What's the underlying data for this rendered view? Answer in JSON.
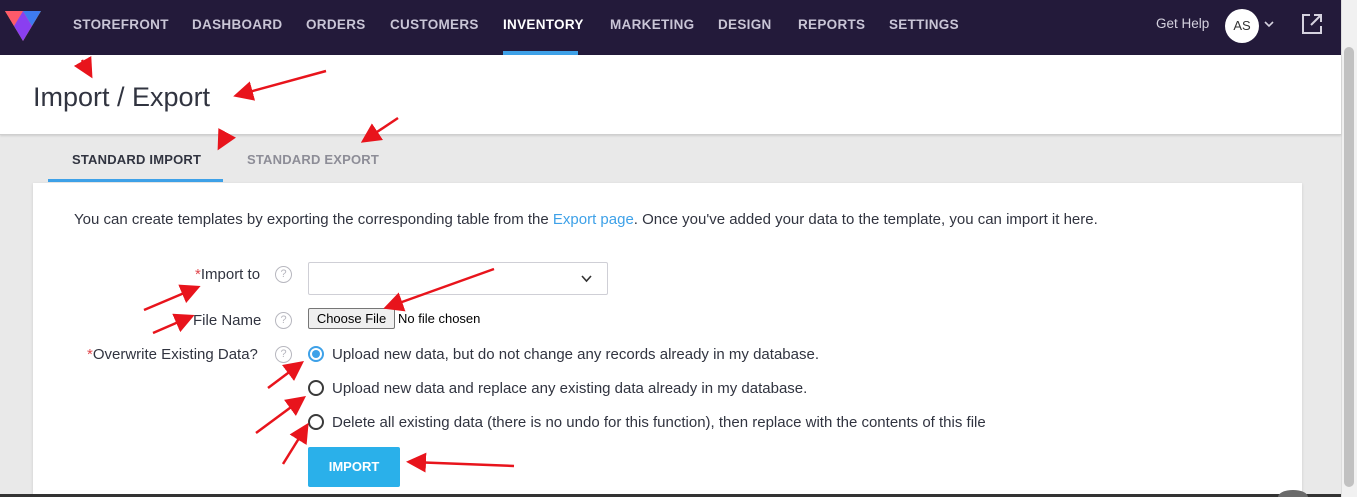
{
  "nav": {
    "items": [
      "STOREFRONT",
      "DASHBOARD",
      "ORDERS",
      "CUSTOMERS",
      "INVENTORY",
      "MARKETING",
      "DESIGN",
      "REPORTS",
      "SETTINGS"
    ],
    "active": "INVENTORY",
    "help": "Get Help",
    "avatar_initials": "AS"
  },
  "page": {
    "title": "Import / Export"
  },
  "tabs": {
    "import": "STANDARD IMPORT",
    "export": "STANDARD EXPORT"
  },
  "form": {
    "intro_before": "You can create templates by exporting the corresponding table from the ",
    "intro_link": "Export page",
    "intro_after": ". Once you've added your data to the template, you can import it here.",
    "required_mark": "*",
    "import_to_label": "Import to",
    "file_name_label": "File Name",
    "choose_file": "Choose File",
    "file_status": "No file chosen",
    "overwrite_label": "Overwrite Existing Data?",
    "help_glyph": "?",
    "options": [
      "Upload new data, but do not change any records already in my database.",
      "Upload new data and replace any existing data already in my database.",
      "Delete all existing data (there is no undo for this function), then replace with the contents of this file"
    ],
    "import_button": "IMPORT"
  },
  "colors": {
    "nav_bg": "#231a3a",
    "accent": "#3ea1e8",
    "import_btn": "#2ab0ea",
    "annotation": "#e8141c"
  }
}
